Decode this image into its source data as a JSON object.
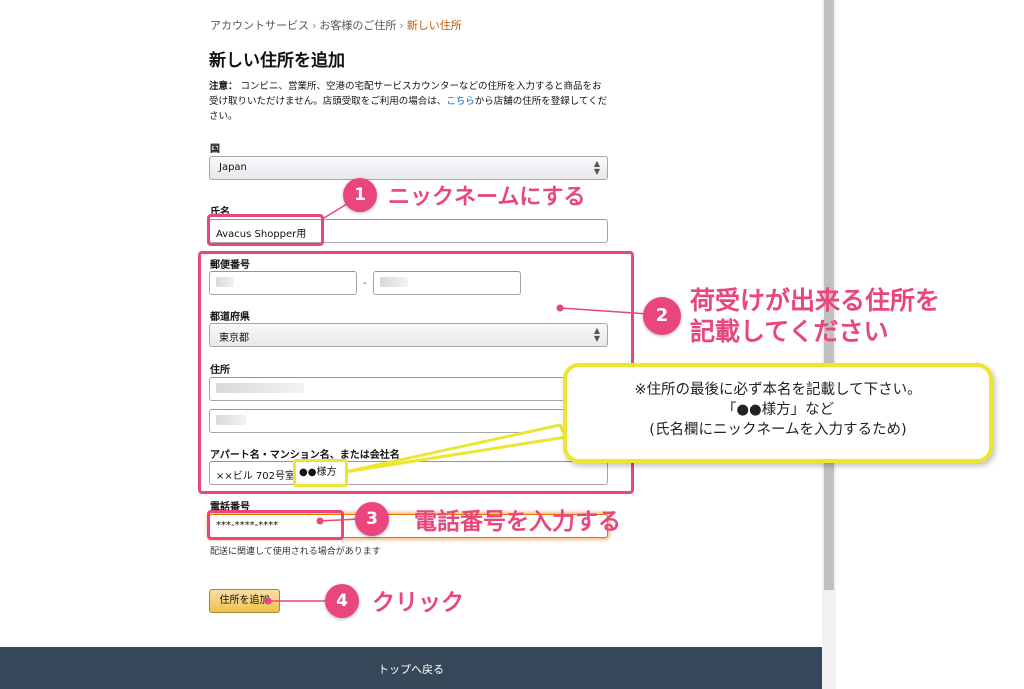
{
  "breadcrumb": {
    "item1": "アカウントサービス",
    "sep": "›",
    "item2": "お客様のご住所",
    "item3": "新しい住所"
  },
  "title": "新しい住所を追加",
  "notice": {
    "label": "注意：",
    "text1": "コンビニ、営業所、空港の宅配サービスカウンターなどの住所を入力すると商品をお受け取りいただけません。店頭受取をご利用の場合は、",
    "link": "こちら",
    "text2": "から店舗の住所を登録してください。"
  },
  "form": {
    "country_label": "国",
    "country_value": "Japan",
    "name_label": "氏名",
    "name_value": "Avacus Shopper用",
    "postal_label": "郵便番号",
    "postal_dash": "-",
    "prefecture_label": "都道府県",
    "prefecture_value": "東京都",
    "address_label": "住所",
    "apartment_label": "アパート名・マンション名、または会社名",
    "apartment_value": "××ビル 702号室",
    "apartment_highlight": "●●様方",
    "phone_label": "電話番号",
    "phone_value": "***-****-****",
    "phone_help": "配送に関連して使用される場合があります",
    "submit_label": "住所を追加"
  },
  "footer": {
    "back_to_top": "トップへ戻る"
  },
  "annotations": {
    "step1": {
      "num": "1",
      "text": "ニックネームにする"
    },
    "step2": {
      "num": "2",
      "line1": "荷受けが出来る住所を",
      "line2": "記載してください"
    },
    "step3": {
      "num": "3",
      "text": "電話番号を入力する"
    },
    "step4": {
      "num": "4",
      "text": "クリック"
    },
    "callout": {
      "line1": "※住所の最後に必ず本名を記載して下さい。",
      "line2": "「●●様方」など",
      "line3": "(氏名欄にニックネームを入力するため)"
    }
  },
  "colors": {
    "annotation_pink": "#e8467c",
    "annotation_yellow": "#ece531",
    "link": "#0066c0",
    "breadcrumb_current": "#c45500",
    "button": "#f0c14b",
    "footer": "#37475a"
  },
  "icons": {
    "select_arrow": "updown-arrow-icon"
  }
}
